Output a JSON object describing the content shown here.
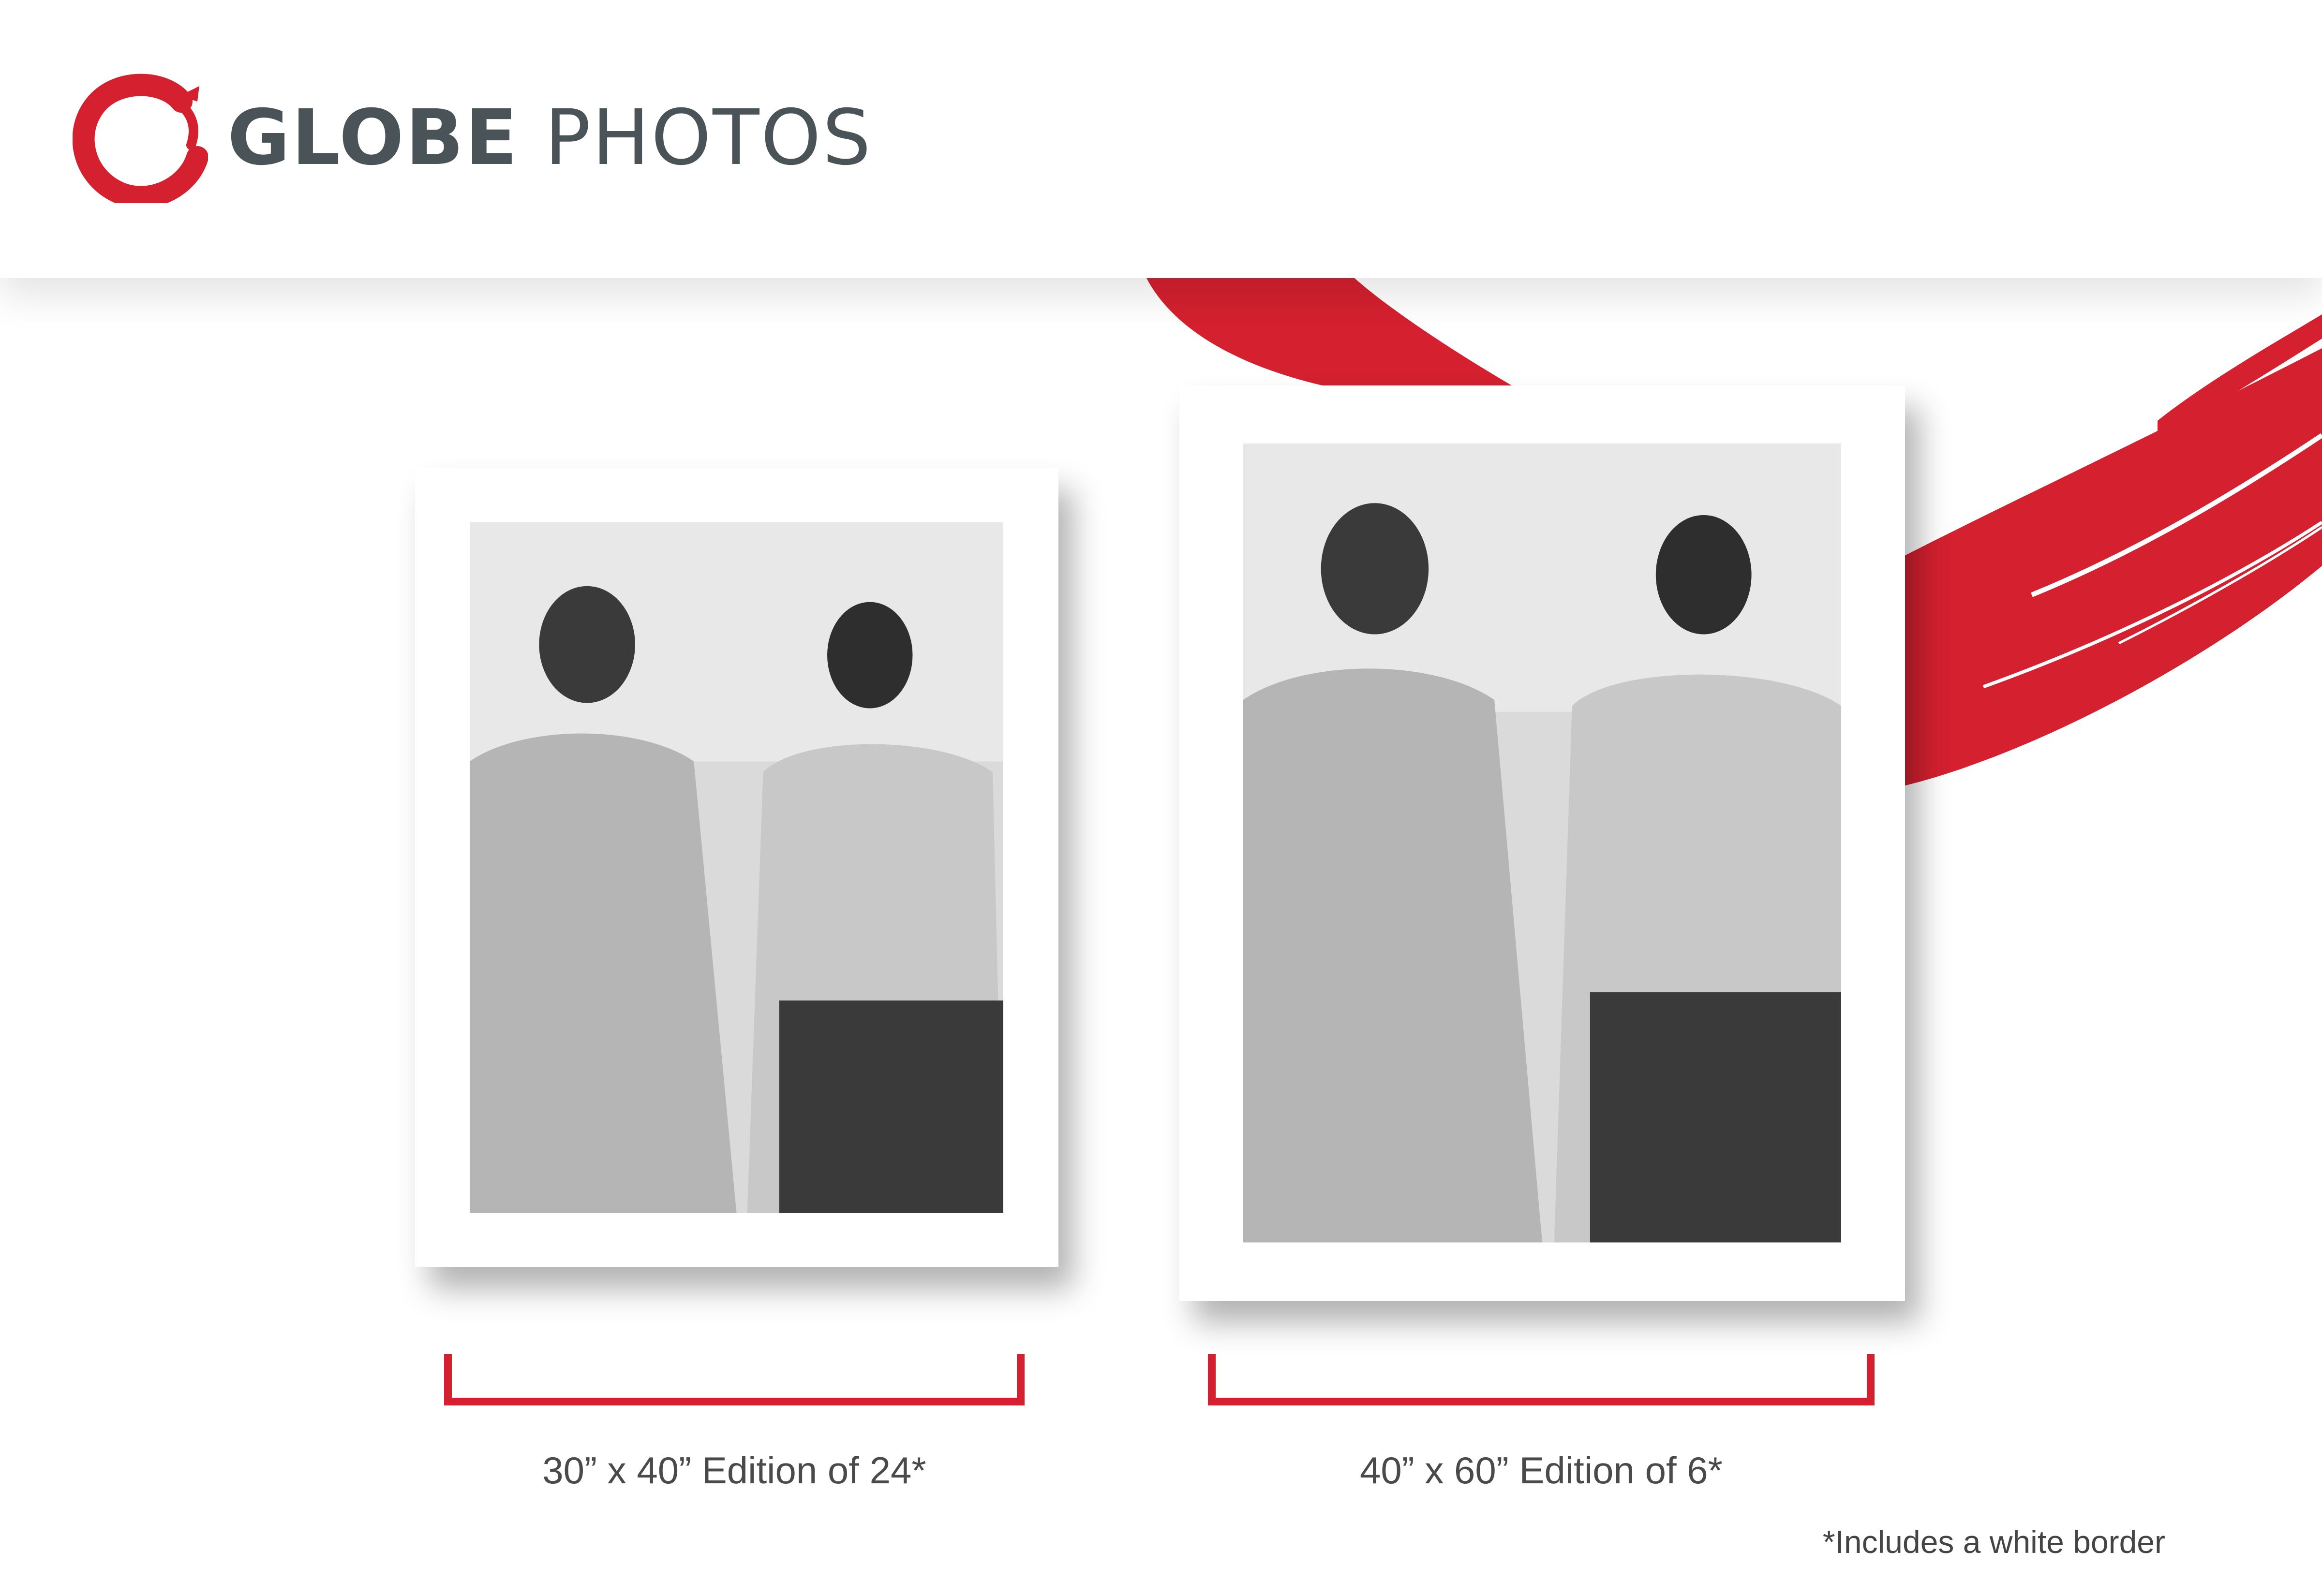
{
  "brand": {
    "name_bold": "GLOBE",
    "name_light": "PHOTOS",
    "logo_icon": "brush-ring-icon",
    "accent_color": "#d4202f",
    "text_color": "#4a5458"
  },
  "prints": [
    {
      "size_label": "30” x 40” Edition of 24*"
    },
    {
      "size_label": "40” x 60” Edition of 6*"
    }
  ],
  "footnote": "*Includes a white border"
}
